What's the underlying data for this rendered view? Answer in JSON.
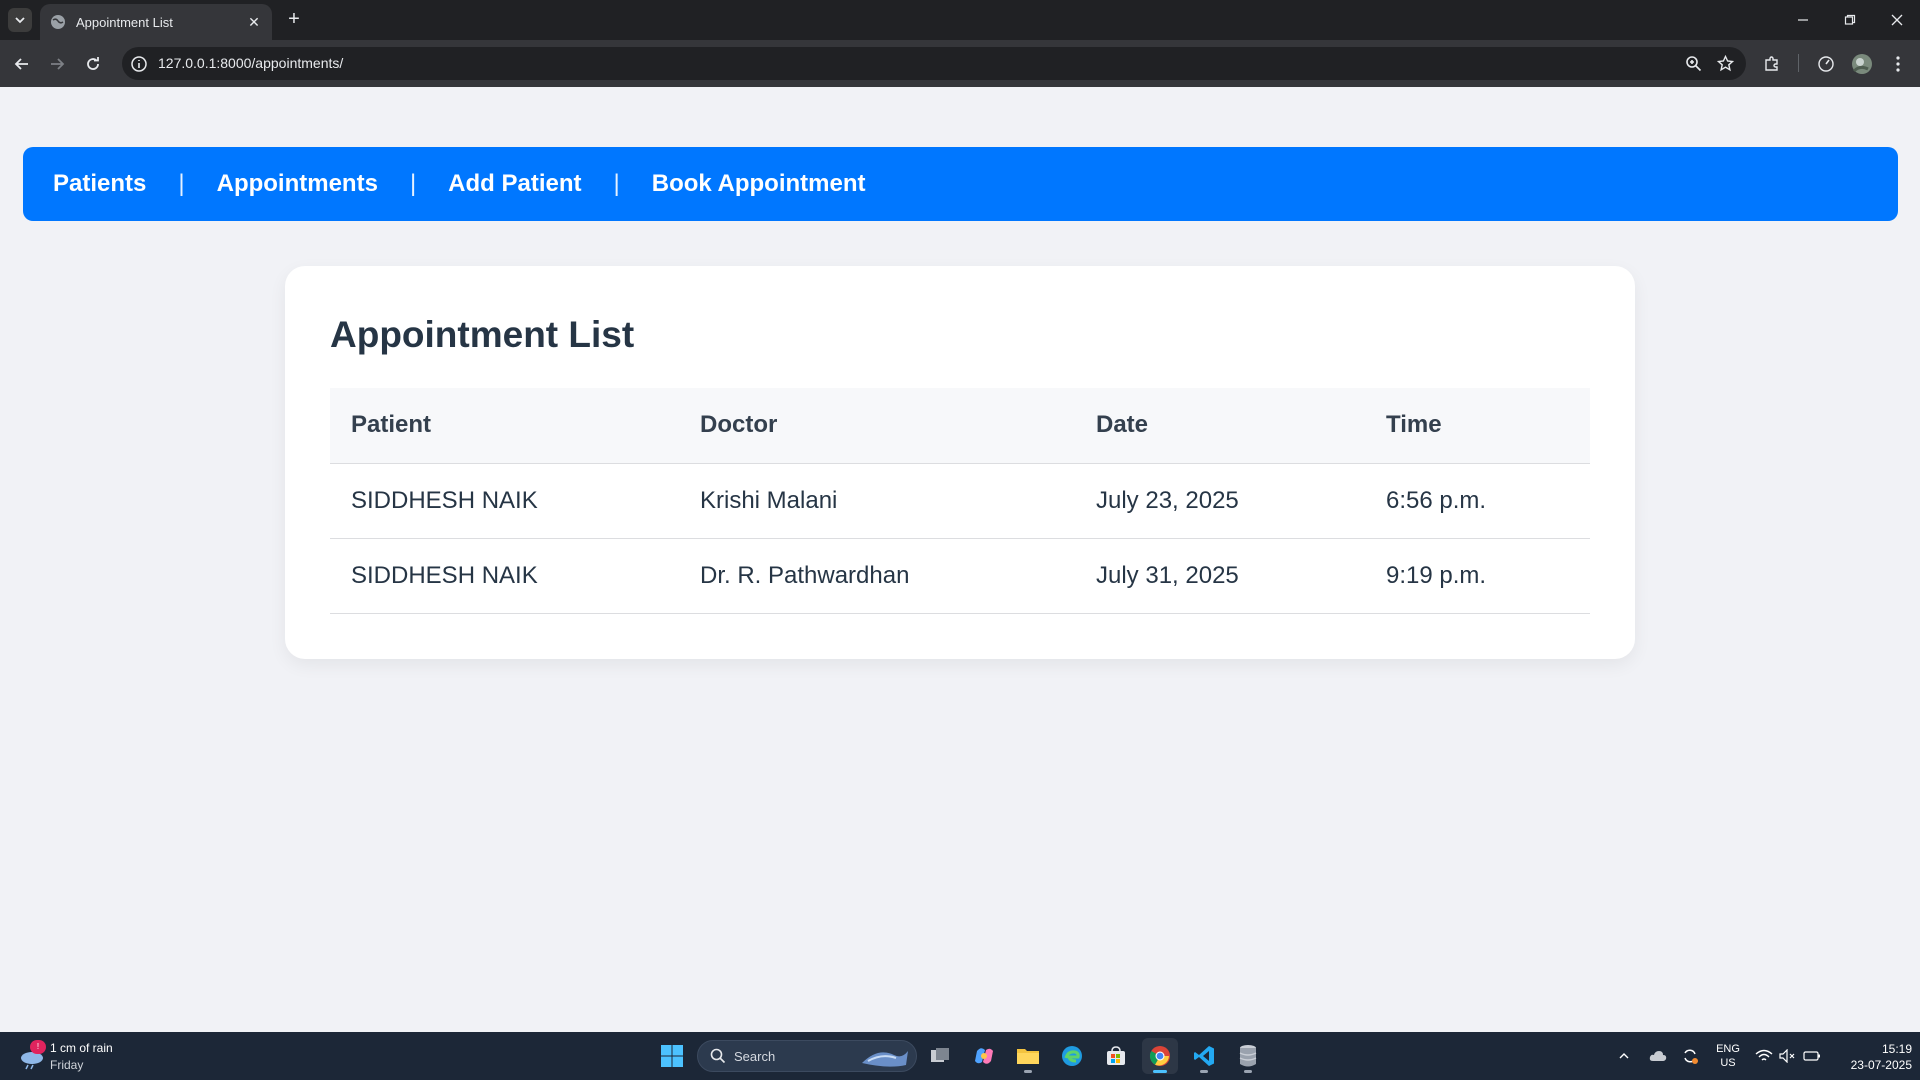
{
  "browser": {
    "tab_title": "Appointment List",
    "url": "127.0.0.1:8000/appointments/",
    "new_tab_label": "+"
  },
  "nav": {
    "links": [
      "Patients",
      "Appointments",
      "Add Patient",
      "Book Appointment"
    ],
    "separator": "|",
    "accent_color": "#0077ff"
  },
  "main": {
    "heading": "Appointment List",
    "columns": [
      "Patient",
      "Doctor",
      "Date",
      "Time"
    ],
    "rows": [
      [
        "SIDDHESH NAIK",
        "Krishi Malani",
        "July 23, 2025",
        "6:56 p.m."
      ],
      [
        "SIDDHESH NAIK",
        "Dr. R. Pathwardhan",
        "July 31, 2025",
        "9:19 p.m."
      ]
    ]
  },
  "taskbar": {
    "weather_text": "1 cm of rain",
    "weather_day": "Friday",
    "search_label": "Search",
    "lang_line1": "ENG",
    "lang_line2": "US",
    "time": "15:19",
    "date": "23-07-2025"
  },
  "icons": {
    "tab_menu": "chevron-down-icon",
    "favicon": "globe-icon",
    "back": "arrow-left-icon",
    "forward": "arrow-right-icon",
    "reload": "reload-icon",
    "site_info": "info-icon",
    "zoom": "zoom-icon",
    "bookmark": "star-icon",
    "extensions": "puzzle-icon",
    "profile": "avatar-icon",
    "menu": "kebab-menu-icon"
  }
}
